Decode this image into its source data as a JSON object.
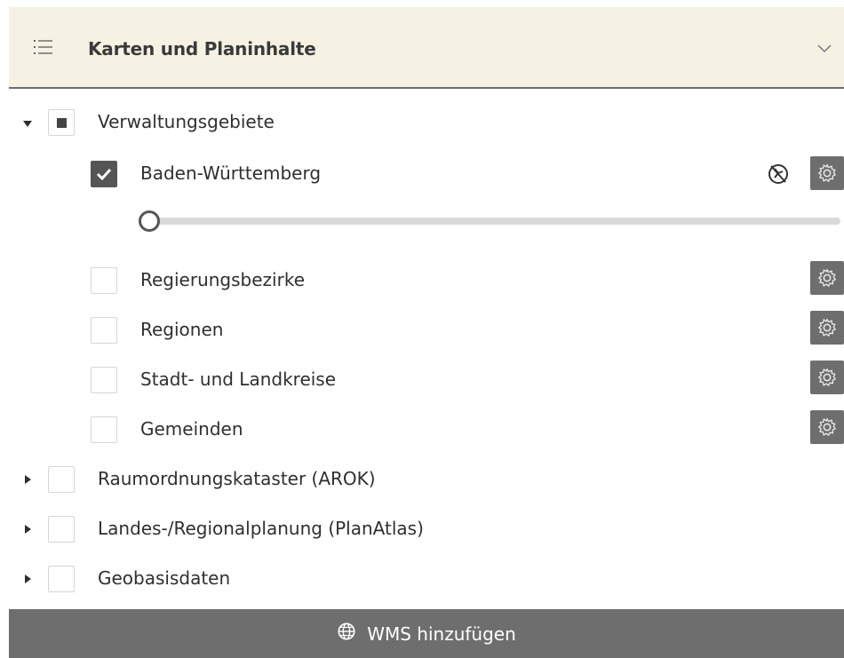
{
  "panel": {
    "title": "Karten und Planinhalte"
  },
  "tree": {
    "verwaltungsgebiete": {
      "label": "Verwaltungsgebiete",
      "expanded": true,
      "state": "partial"
    },
    "children": [
      {
        "label": "Baden-Württemberg",
        "checked": true
      },
      {
        "label": "Regierungsbezirke",
        "checked": false
      },
      {
        "label": "Regionen",
        "checked": false
      },
      {
        "label": "Stadt- und Landkreise",
        "checked": false
      },
      {
        "label": "Gemeinden",
        "checked": false
      }
    ],
    "groups": [
      {
        "label": "Raumordnungskataster (AROK)",
        "expanded": false,
        "checked": false
      },
      {
        "label": "Landes-/Regionalplanung (PlanAtlas)",
        "expanded": false,
        "checked": false
      },
      {
        "label": "Geobasisdaten",
        "expanded": false,
        "checked": false
      }
    ]
  },
  "opacity_slider": {
    "value": 0
  },
  "footer": {
    "label": "WMS hinzufügen"
  },
  "colors": {
    "header_bg": "#f5f2e3",
    "button_bg": "#6e6e6e",
    "checked_bg": "#555555"
  },
  "icons": [
    "list-icon",
    "chevron-down-icon",
    "caret-down-icon",
    "caret-right-icon",
    "checkmark-icon",
    "globe-crossed-icon",
    "gear-icon",
    "globe-icon"
  ]
}
